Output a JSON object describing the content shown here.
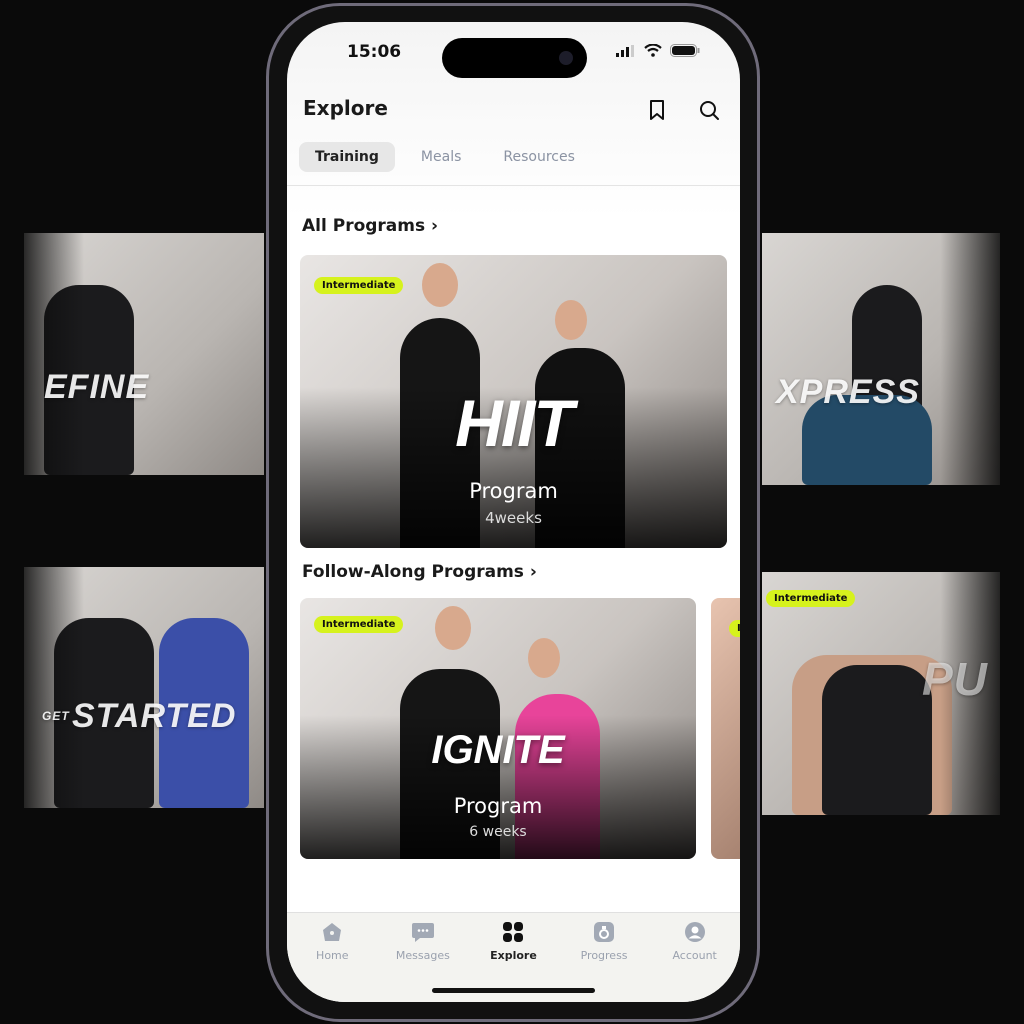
{
  "status_bar": {
    "time": "15:06"
  },
  "header": {
    "title": "Explore"
  },
  "tabs": [
    {
      "label": "Training",
      "active": true
    },
    {
      "label": "Meals",
      "active": false
    },
    {
      "label": "Resources",
      "active": false
    }
  ],
  "sections": [
    {
      "title": "All Programs",
      "chevron": "›"
    },
    {
      "title": "Follow-Along Programs",
      "chevron": "›"
    }
  ],
  "cards": {
    "hiit": {
      "badge": "Intermediate",
      "logo": "HIIT",
      "label": "Program",
      "duration": "4weeks"
    },
    "ignite": {
      "badge": "Intermediate",
      "logo": "IGNITE",
      "label": "Program",
      "duration": "6 weeks"
    },
    "peek": {
      "badge": "In"
    }
  },
  "side_cards": {
    "left_top": "EFINE",
    "left_bottom": "STARTED",
    "left_bottom_small": "GET",
    "right_top": "XPRESS",
    "right_bottom": "PU",
    "right_bottom_badge": "Intermediate"
  },
  "nav": [
    {
      "label": "Home",
      "icon": "home-icon",
      "active": false
    },
    {
      "label": "Messages",
      "icon": "chat-icon",
      "active": false
    },
    {
      "label": "Explore",
      "icon": "grid-icon",
      "active": true
    },
    {
      "label": "Progress",
      "icon": "progress-icon",
      "active": false
    },
    {
      "label": "Account",
      "icon": "account-icon",
      "active": false
    }
  ],
  "colors": {
    "badge": "#d6f21d",
    "nav_active": "#222222",
    "nav_inactive": "#9aa1ae"
  }
}
